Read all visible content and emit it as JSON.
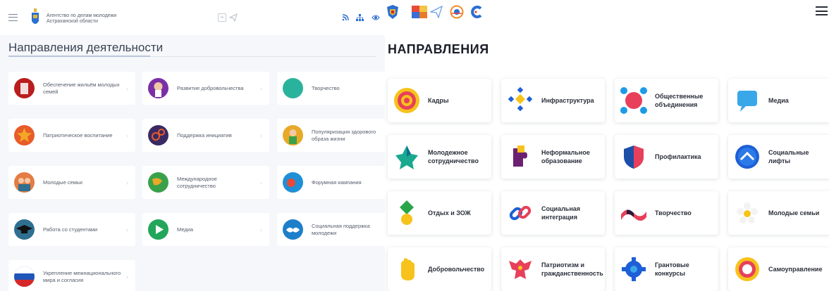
{
  "left_header": {
    "org_line1": "Агентство по делам молодежи",
    "org_line2": "Астраханской области",
    "icons": [
      "menu-icon",
      "coat-of-arms-icon",
      "vk-icon",
      "telegram-icon",
      "rss-icon",
      "sitemap-icon",
      "eye-icon"
    ],
    "vk_label": "vk"
  },
  "left_section": {
    "title": "Направления деятельности",
    "items": [
      {
        "label": "Обеспечение жильём молодых семей",
        "icon": "house-icon",
        "color": "#b91d1d"
      },
      {
        "label": "Развитие добровольчества",
        "icon": "volunteer-icon",
        "color": "#7b2fa6"
      },
      {
        "label": "Творчество",
        "icon": "bird-icon",
        "color": "#2ab39c"
      },
      {
        "label": "Патриотическое воспитание",
        "icon": "star-icon",
        "color": "#e85b2a"
      },
      {
        "label": "Поддержка инициатив",
        "icon": "gears-icon",
        "color": "#3a2a63"
      },
      {
        "label": "Популяризация здорового образа жизни",
        "icon": "sport-icon",
        "color": "#e8a928"
      },
      {
        "label": "Молодые семьи",
        "icon": "family-icon",
        "color": "#e57b45"
      },
      {
        "label": "Международное сотрудничество",
        "icon": "globe-icon",
        "color": "#3aa14b"
      },
      {
        "label": "Форумная кампания",
        "icon": "forum-icon",
        "color": "#1f8fd6"
      },
      {
        "label": "Работа со студентами",
        "icon": "graduation-cap-icon",
        "color": "#2f6f8f"
      },
      {
        "label": "Медиа",
        "icon": "play-icon",
        "color": "#23a65a"
      },
      {
        "label": "Социальная поддержка молодежи",
        "icon": "handshake-icon",
        "color": "#1d7fc9"
      },
      {
        "label": "Укрепление межнационального мира и согласия",
        "icon": "flag-icon",
        "color": "#1f55b8"
      }
    ],
    "chevron": "›"
  },
  "right_header": {
    "icons": [
      "emblem-icon",
      "flag-icon",
      "paper-plane-icon",
      "badge-icon",
      "c-logo-icon",
      "menu-icon"
    ]
  },
  "right_section": {
    "title": "НАПРАВЛЕНИЯ",
    "items": [
      {
        "label": "Кадры",
        "icon": "target-icon"
      },
      {
        "label": "Инфраструктура",
        "icon": "diamonds-icon"
      },
      {
        "label": "Общественные объединения",
        "icon": "circles-icon"
      },
      {
        "label": "Медиа",
        "icon": "chat-bubble-icon"
      },
      {
        "label": "Молодежное сотрудничество",
        "icon": "star-shape-icon"
      },
      {
        "label": "Неформальное образование",
        "icon": "puzzle-icon"
      },
      {
        "label": "Профилактика",
        "icon": "shield-icon"
      },
      {
        "label": "Социальные лифты",
        "icon": "chevron-up-icon"
      },
      {
        "label": "Отдых и ЗОЖ",
        "icon": "medal-icon"
      },
      {
        "label": "Социальная интеграция",
        "icon": "link-icon"
      },
      {
        "label": "Творчество",
        "icon": "ribbon-icon"
      },
      {
        "label": "Молодые семьи",
        "icon": "flower-icon"
      },
      {
        "label": "Добровольчество",
        "icon": "hand-icon"
      },
      {
        "label": "Патриотизм и гражданственность",
        "icon": "eagle-icon"
      },
      {
        "label": "Грантовые конкурсы",
        "icon": "gear-icon"
      },
      {
        "label": "Самоуправление",
        "icon": "ring-icon"
      }
    ]
  }
}
